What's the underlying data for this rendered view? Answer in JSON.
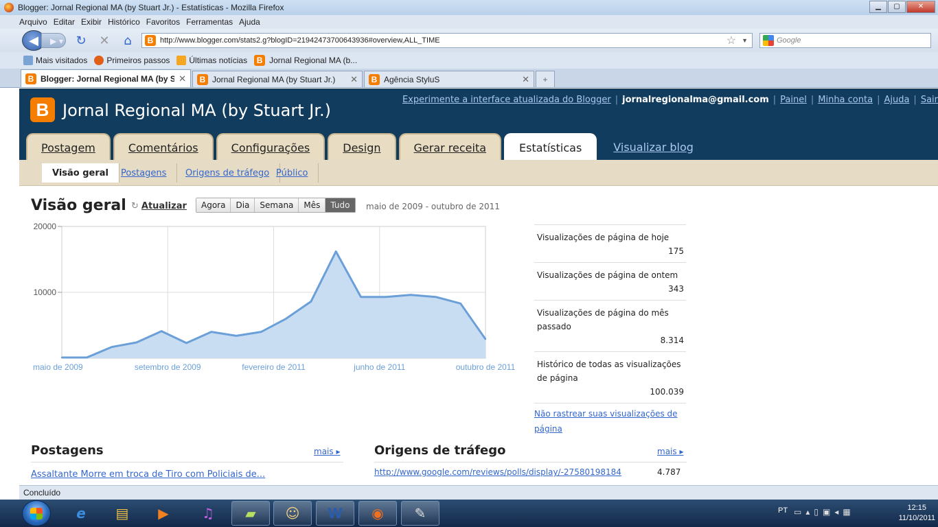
{
  "window": {
    "title": "Blogger: Jornal Regional MA (by Stuart Jr.) - Estatísticas - Mozilla Firefox"
  },
  "menu": [
    "Arquivo",
    "Editar",
    "Exibir",
    "Histórico",
    "Favoritos",
    "Ferramentas",
    "Ajuda"
  ],
  "address": {
    "url": "http://www.blogger.com/stats2.g?blogID=2194247370064393​6#overview,ALL_TIME",
    "search_placeholder": "Google"
  },
  "bookmarks": [
    "Mais visitados",
    "Primeiros passos",
    "Últimas notícias",
    "Jornal Regional MA (b..."
  ],
  "tabs": [
    {
      "label": "Blogger: Jornal Regional MA (by S..."
    },
    {
      "label": "Jornal Regional MA (by Stuart Jr.)"
    },
    {
      "label": "Agência StyluS"
    }
  ],
  "header": {
    "blog_title": "Jornal Regional MA (by Stuart Jr.)",
    "logo_letter": "B",
    "try_link": "Experimente a interface atualizada do Blogger",
    "email": "jornalregionalma@gmail.com",
    "links": [
      "Painel",
      "Minha conta",
      "Ajuda",
      "Sair"
    ]
  },
  "main_tabs": [
    "Postagem",
    "Comentários",
    "Configurações",
    "Design",
    "Gerar receita",
    "Estatísticas",
    "Visualizar blog"
  ],
  "sub_tabs": [
    "Visão geral",
    "Postagens",
    "Origens de tráfego",
    "Público"
  ],
  "overview": {
    "title": "Visão geral",
    "refresh": "Atualizar",
    "ranges": [
      "Agora",
      "Dia",
      "Semana",
      "Mês",
      "Tudo"
    ],
    "date_range": "maio de 2009 - outubro de 2011"
  },
  "chart_data": {
    "type": "area",
    "x_labels": [
      "maio de 2009",
      "setembro de 2009",
      "fevereiro de 2011",
      "junho de 2011",
      "outubro de 2011"
    ],
    "y_ticks": [
      "20000",
      "10000"
    ],
    "ylim": [
      0,
      20000
    ],
    "values": [
      100,
      100,
      1700,
      2400,
      4100,
      2300,
      4000,
      3400,
      4000,
      6000,
      8600,
      16200,
      9300,
      9300,
      9600,
      9300,
      8300,
      2900
    ],
    "color": "#6a9fd8",
    "fill": "#c9ddf2",
    "grid": true
  },
  "stats": [
    {
      "label": "Visualizações de página de hoje",
      "value": "175"
    },
    {
      "label": "Visualizações de página de ontem",
      "value": "343"
    },
    {
      "label": "Visualizações de página do mês passado",
      "value": "8.314"
    },
    {
      "label": "Histórico de todas as visualizações de página",
      "value": "100.039"
    }
  ],
  "no_track_link": "Não rastrear suas visualizações de página",
  "posts_section": {
    "title": "Postagens",
    "more": "mais ▸",
    "first": "Assaltante Morre em troca de Tiro com Policiais de..."
  },
  "traffic_section": {
    "title": "Origens de tráfego",
    "more": "mais ▸",
    "first_url": "http://www.google.com/reviews/polls/display/-27580198184",
    "first_count": "4.787"
  },
  "status": "Concluído",
  "taskbar": {
    "lang": "PT",
    "time": "12:15",
    "date": "11/10/2011"
  }
}
